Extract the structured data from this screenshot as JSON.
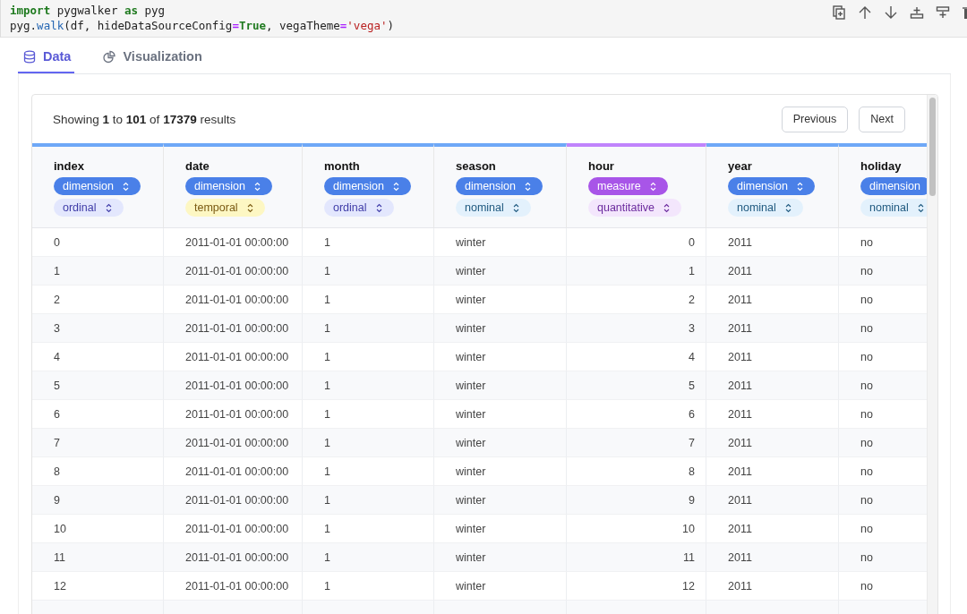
{
  "code_cell": {
    "lines": [
      [
        {
          "text": "import",
          "kind": "keyword"
        },
        {
          "text": " pygwalker ",
          "kind": "plain"
        },
        {
          "text": "as",
          "kind": "keyword"
        },
        {
          "text": " pyg",
          "kind": "plain"
        }
      ],
      [
        {
          "text": "pyg.",
          "kind": "plain"
        },
        {
          "text": "walk",
          "kind": "function"
        },
        {
          "text": "(df, hideDataSourceConfig",
          "kind": "plain"
        },
        {
          "text": "=",
          "kind": "operator"
        },
        {
          "text": "True",
          "kind": "keyword"
        },
        {
          "text": ", vegaTheme",
          "kind": "plain"
        },
        {
          "text": "=",
          "kind": "operator"
        },
        {
          "text": "'vega'",
          "kind": "string"
        },
        {
          "text": ")",
          "kind": "plain"
        }
      ]
    ],
    "toolbar": [
      {
        "kind": "copy"
      },
      {
        "kind": "up"
      },
      {
        "kind": "down"
      },
      {
        "kind": "insert-above"
      },
      {
        "kind": "insert-below"
      },
      {
        "kind": "delete"
      }
    ]
  },
  "tabs": [
    {
      "label": "Data",
      "kind": "data",
      "selected": true
    },
    {
      "label": "Visualization",
      "kind": "chart",
      "selected": false
    }
  ],
  "summary": "Showing **1** to **101** of **17379** results",
  "pager": [
    "Previous",
    "Next"
  ],
  "table": {
    "columns": [
      {
        "name": "index",
        "role": "dimension",
        "semantic": "ordinal",
        "kind": "text"
      },
      {
        "name": "date",
        "role": "dimension",
        "semantic": "temporal",
        "kind": "text"
      },
      {
        "name": "month",
        "role": "dimension",
        "semantic": "ordinal",
        "kind": "text"
      },
      {
        "name": "season",
        "role": "dimension",
        "semantic": "nominal",
        "kind": "text"
      },
      {
        "name": "hour",
        "role": "measure",
        "semantic": "quantitative",
        "kind": "number"
      },
      {
        "name": "year",
        "role": "dimension",
        "semantic": "nominal",
        "kind": "text"
      },
      {
        "name": "holiday",
        "role": "dimension",
        "semantic": "nominal",
        "kind": "text"
      }
    ],
    "rows": [
      [
        "0",
        "2011-01-01 00:00:00",
        "1",
        "winter",
        "0",
        "2011",
        "no"
      ],
      [
        "1",
        "2011-01-01 00:00:00",
        "1",
        "winter",
        "1",
        "2011",
        "no"
      ],
      [
        "2",
        "2011-01-01 00:00:00",
        "1",
        "winter",
        "2",
        "2011",
        "no"
      ],
      [
        "3",
        "2011-01-01 00:00:00",
        "1",
        "winter",
        "3",
        "2011",
        "no"
      ],
      [
        "4",
        "2011-01-01 00:00:00",
        "1",
        "winter",
        "4",
        "2011",
        "no"
      ],
      [
        "5",
        "2011-01-01 00:00:00",
        "1",
        "winter",
        "5",
        "2011",
        "no"
      ],
      [
        "6",
        "2011-01-01 00:00:00",
        "1",
        "winter",
        "6",
        "2011",
        "no"
      ],
      [
        "7",
        "2011-01-01 00:00:00",
        "1",
        "winter",
        "7",
        "2011",
        "no"
      ],
      [
        "8",
        "2011-01-01 00:00:00",
        "1",
        "winter",
        "8",
        "2011",
        "no"
      ],
      [
        "9",
        "2011-01-01 00:00:00",
        "1",
        "winter",
        "9",
        "2011",
        "no"
      ],
      [
        "10",
        "2011-01-01 00:00:00",
        "1",
        "winter",
        "10",
        "2011",
        "no"
      ],
      [
        "11",
        "2011-01-01 00:00:00",
        "1",
        "winter",
        "11",
        "2011",
        "no"
      ],
      [
        "12",
        "2011-01-01 00:00:00",
        "1",
        "winter",
        "12",
        "2011",
        "no"
      ]
    ]
  }
}
